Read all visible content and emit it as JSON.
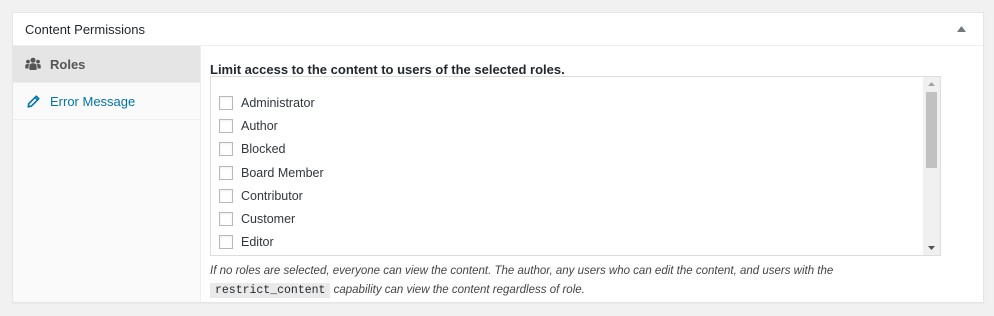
{
  "postbox": {
    "title": "Content Permissions",
    "toggle_icon": "triangle-up-icon"
  },
  "tabs": [
    {
      "label": "Roles",
      "icon": "users-icon",
      "active": true
    },
    {
      "label": "Error Message",
      "icon": "pencil-icon",
      "active": false
    }
  ],
  "panel": {
    "heading": "Limit access to the content to users of the selected roles.",
    "roles": [
      {
        "label": "Administrator",
        "checked": false
      },
      {
        "label": "Author",
        "checked": false
      },
      {
        "label": "Blocked",
        "checked": false
      },
      {
        "label": "Board Member",
        "checked": false
      },
      {
        "label": "Contributor",
        "checked": false
      },
      {
        "label": "Customer",
        "checked": false
      },
      {
        "label": "Editor",
        "checked": false
      }
    ],
    "help_before": "If no roles are selected, everyone can view the content. The author, any users who can edit the content, and users with the",
    "help_code": "restrict_content",
    "help_after": "capability can view the content regardless of role."
  },
  "colors": {
    "link": "#0073aa",
    "active_tab_bg": "#e5e5e5",
    "page_bg": "#f1f1f1"
  }
}
